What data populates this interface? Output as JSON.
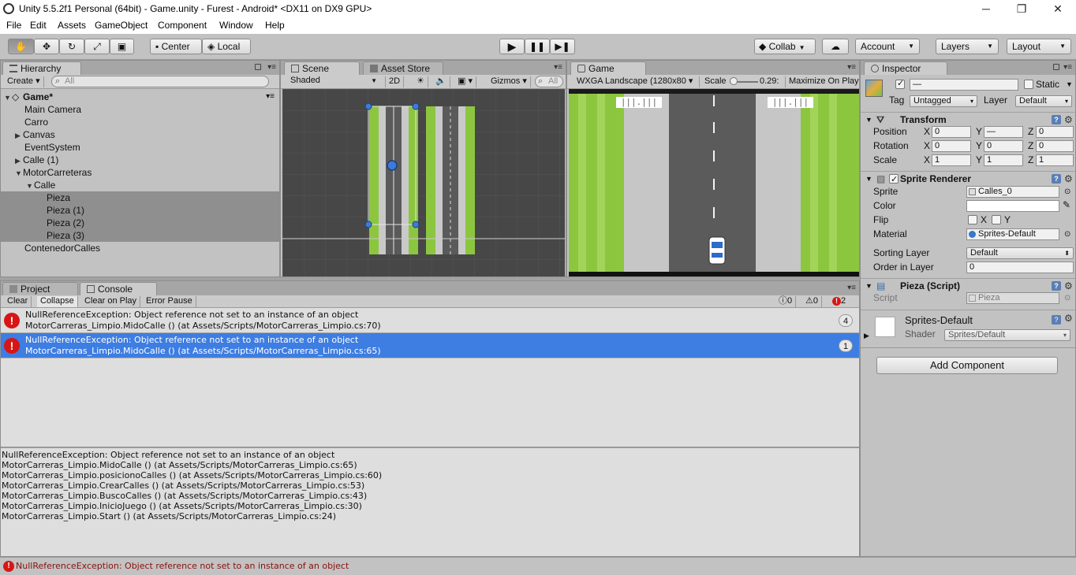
{
  "window": {
    "title": "Unity 5.5.2f1 Personal (64bit) - Game.unity - Furest - Android* <DX11 on DX9 GPU>",
    "minimize": "─",
    "maximize": "❐",
    "close": "✕"
  },
  "menu": [
    "File",
    "Edit",
    "Assets",
    "GameObject",
    "Component",
    "Window",
    "Help"
  ],
  "toolbar": {
    "pivot": "Center",
    "space": "Local",
    "collab": "Collab",
    "account": "Account",
    "layers": "Layers",
    "layout": "Layout"
  },
  "hierarchy": {
    "tab": "Hierarchy",
    "create": "Create",
    "search_placeholder": "All",
    "scene": "Game*",
    "items": [
      {
        "label": "Main Camera"
      },
      {
        "label": "Carro"
      },
      {
        "label": "Canvas"
      },
      {
        "label": "EventSystem"
      },
      {
        "label": "Calle (1)"
      },
      {
        "label": "MotorCarreteras"
      },
      {
        "label": "Calle"
      },
      {
        "label": "Pieza"
      },
      {
        "label": "Pieza (1)"
      },
      {
        "label": "Pieza (2)"
      },
      {
        "label": "Pieza (3)"
      },
      {
        "label": "ContenedorCalles"
      }
    ]
  },
  "scene_view": {
    "tab": "Scene",
    "tab2": "Asset Store",
    "shading": "Shaded",
    "mode_2d": "2D",
    "gizmos": "Gizmos",
    "search_placeholder": "All"
  },
  "game_view": {
    "tab": "Game",
    "aspect": "WXGA Landscape (1280x80",
    "scale_label": "Scale",
    "scale_value": "0.29:",
    "maximize": "Maximize On Play",
    "score_left": "|||.|||",
    "score_right": "|||.|||"
  },
  "console": {
    "tab_project": "Project",
    "tab_console": "Console",
    "clear": "Clear",
    "collapse": "Collapse",
    "clear_on_play": "Clear on Play",
    "error_pause": "Error Pause",
    "info_count": "0",
    "warn_count": "0",
    "error_count": "2",
    "entries": [
      {
        "line1": "NullReferenceException: Object reference not set to an instance of an object",
        "line2": "MotorCarreras_Limpio.MidoCalle () (at Assets/Scripts/MotorCarreras_Limpio.cs:70)",
        "count": "4"
      },
      {
        "line1": "NullReferenceException: Object reference not set to an instance of an object",
        "line2": "MotorCarreras_Limpio.MidoCalle () (at Assets/Scripts/MotorCarreras_Limpio.cs:65)",
        "count": "1"
      }
    ],
    "stack": [
      "NullReferenceException: Object reference not set to an instance of an object",
      "MotorCarreras_Limpio.MidoCalle () (at Assets/Scripts/MotorCarreras_Limpio.cs:65)",
      "MotorCarreras_Limpio.posicionoCalles () (at Assets/Scripts/MotorCarreras_Limpio.cs:60)",
      "MotorCarreras_Limpio.CrearCalles () (at Assets/Scripts/MotorCarreras_Limpio.cs:53)",
      "MotorCarreras_Limpio.BuscoCalles () (at Assets/Scripts/MotorCarreras_Limpio.cs:43)",
      "MotorCarreras_Limpio.InicioJuego () (at Assets/Scripts/MotorCarreras_Limpio.cs:30)",
      "MotorCarreras_Limpio.Start () (at Assets/Scripts/MotorCarreras_Limpio.cs:24)"
    ]
  },
  "inspector": {
    "tab": "Inspector",
    "name_value": "—",
    "static": "Static",
    "tag_label": "Tag",
    "tag_value": "Untagged",
    "layer_label": "Layer",
    "layer_value": "Default",
    "transform": {
      "title": "Transform",
      "position_label": "Position",
      "rotation_label": "Rotation",
      "scale_label": "Scale",
      "x": "X",
      "y": "Y",
      "z": "Z",
      "position": [
        "0",
        "—",
        "0"
      ],
      "rotation": [
        "0",
        "0",
        "0"
      ],
      "scale": [
        "1",
        "1",
        "1"
      ]
    },
    "sprite_renderer": {
      "title": "Sprite Renderer",
      "sprite_label": "Sprite",
      "sprite_value": "Calles_0",
      "color_label": "Color",
      "flip_label": "Flip",
      "flip_x": "X",
      "flip_y": "Y",
      "material_label": "Material",
      "material_value": "Sprites-Default",
      "sorting_layer_label": "Sorting Layer",
      "sorting_layer_value": "Default",
      "order_label": "Order in Layer",
      "order_value": "0"
    },
    "script_comp": {
      "title": "Pieza (Script)",
      "script_label": "Script",
      "script_value": "Pieza"
    },
    "material": {
      "title": "Sprites-Default",
      "shader_label": "Shader",
      "shader_value": "Sprites/Default"
    },
    "add_component": "Add Component"
  },
  "status": {
    "message": "NullReferenceException: Object reference not set to an instance of an object"
  }
}
